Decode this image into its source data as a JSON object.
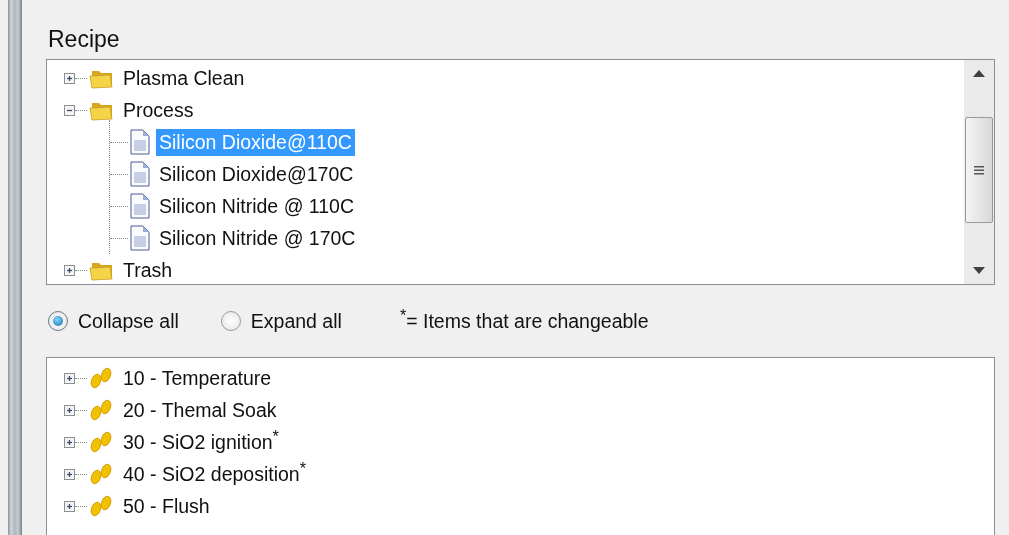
{
  "recipe": {
    "title": "Recipe",
    "tree": [
      {
        "kind": "folder",
        "label": "Plasma Clean",
        "expanded": false
      },
      {
        "kind": "folder",
        "label": "Process",
        "expanded": true,
        "children": [
          {
            "kind": "file",
            "label": "Silicon Dioxide@110C",
            "selected": true
          },
          {
            "kind": "file",
            "label": "Silicon Dioxide@170C",
            "selected": false
          },
          {
            "kind": "file",
            "label": "Silicon Nitride @ 110C",
            "selected": false
          },
          {
            "kind": "file",
            "label": "Silicon Nitride @ 170C",
            "selected": false
          }
        ]
      },
      {
        "kind": "folder",
        "label": "Trash",
        "expanded": false
      }
    ]
  },
  "view_options": [
    {
      "label": "Collapse all",
      "selected": true
    },
    {
      "label": "Expand all",
      "selected": false
    }
  ],
  "note": "$^{*}$= Items that are changeable",
  "steps": [
    {
      "label": "10 - Temperature",
      "expanded": false
    },
    {
      "label": "20 - Themal Soak",
      "expanded": false
    },
    {
      "label": "30 - SiO2 ignition$^{*}$",
      "expanded": false
    },
    {
      "label": "40 - SiO2 deposition$^{*}$",
      "expanded": false
    },
    {
      "label": "50 - Flush",
      "expanded": false
    }
  ]
}
